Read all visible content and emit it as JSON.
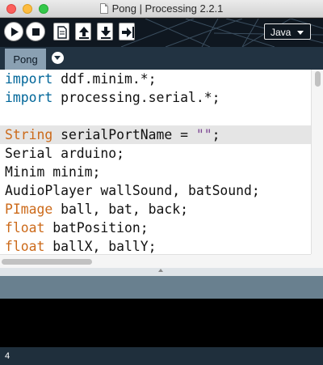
{
  "window": {
    "title": "Pong | Processing 2.2.1"
  },
  "toolbar": {
    "buttons": [
      {
        "name": "run",
        "icon": "play-icon"
      },
      {
        "name": "stop",
        "icon": "stop-icon"
      },
      {
        "name": "new",
        "icon": "new-file-icon"
      },
      {
        "name": "open",
        "icon": "open-upload-icon"
      },
      {
        "name": "save",
        "icon": "save-download-icon"
      },
      {
        "name": "export",
        "icon": "export-icon"
      }
    ],
    "mode": "Java"
  },
  "tabs": [
    {
      "label": "Pong"
    }
  ],
  "editor": {
    "lines": [
      {
        "parts": [
          {
            "t": "import",
            "c": "kw2"
          },
          {
            "t": " ddf.minim.*;"
          }
        ]
      },
      {
        "parts": [
          {
            "t": "import",
            "c": "kw2"
          },
          {
            "t": " processing.serial.*;"
          }
        ]
      },
      {
        "parts": [
          {
            "t": ""
          }
        ]
      },
      {
        "parts": [
          {
            "t": "String",
            "c": "kw"
          },
          {
            "t": " serialPortName = "
          },
          {
            "t": "\"\"",
            "c": "str"
          },
          {
            "t": ";"
          }
        ],
        "current": true
      },
      {
        "parts": [
          {
            "t": "Serial arduino;"
          }
        ]
      },
      {
        "parts": [
          {
            "t": "Minim minim;"
          }
        ]
      },
      {
        "parts": [
          {
            "t": "AudioPlayer wallSound, batSound;"
          }
        ]
      },
      {
        "parts": [
          {
            "t": "PImage",
            "c": "kw"
          },
          {
            "t": " ball, bat, back;"
          }
        ]
      },
      {
        "parts": [
          {
            "t": "float",
            "c": "kw"
          },
          {
            "t": " batPosition;"
          }
        ]
      },
      {
        "parts": [
          {
            "t": "float",
            "c": "kw"
          },
          {
            "t": " ballX, ballY;"
          }
        ]
      }
    ]
  },
  "status": {
    "line_number": "4"
  },
  "colors": {
    "keyword": "#cc6a1a",
    "import_keyword": "#006699",
    "string": "#7d4793",
    "toolbar_bg": "#0f1720",
    "tab_bar_bg": "#223342",
    "message_bg": "#69808f",
    "status_bg": "#1f2f3c"
  }
}
